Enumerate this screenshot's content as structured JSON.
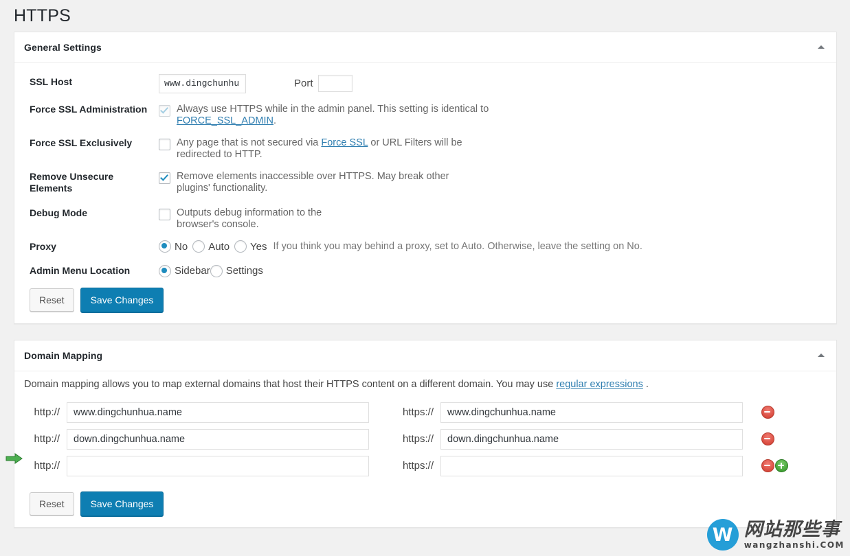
{
  "page": {
    "title": "HTTPS"
  },
  "general": {
    "heading": "General Settings",
    "toggle_icon": "triangle-up-icon",
    "rows": {
      "ssl_host": {
        "label": "SSL Host",
        "value": "www.dingchunhu",
        "placeholder": "",
        "port_label": "Port",
        "port_value": "",
        "port_placeholder": ""
      },
      "force_ssl_admin": {
        "label": "Force SSL Administration",
        "checked": true,
        "disabled": true,
        "text_before": "Always use HTTPS while in the admin panel. This setting is identical to ",
        "link_text": "FORCE_SSL_ADMIN",
        "text_after": "."
      },
      "force_ssl_exclusively": {
        "label": "Force SSL Exclusively",
        "checked": false,
        "text_before": "Any page that is not secured via ",
        "link_text": "Force SSL",
        "text_after": " or URL Filters will be redirected to HTTP."
      },
      "remove_unsecure": {
        "label": "Remove Unsecure Elements",
        "checked": true,
        "text": "Remove elements inaccessible over HTTPS. May break other plugins' functionality."
      },
      "debug_mode": {
        "label": "Debug Mode",
        "checked": false,
        "text": "Outputs debug information to the browser's console."
      },
      "proxy": {
        "label": "Proxy",
        "options": [
          "No",
          "Auto",
          "Yes"
        ],
        "selected": "No",
        "hint": "If you think you may behind a proxy, set to Auto. Otherwise, leave the setting on No."
      },
      "admin_menu_location": {
        "label": "Admin Menu Location",
        "options": [
          "Sidebar",
          "Settings"
        ],
        "selected": "Sidebar"
      }
    },
    "buttons": {
      "reset": "Reset",
      "save": "Save Changes"
    }
  },
  "domain_mapping": {
    "heading": "Domain Mapping",
    "toggle_icon": "triangle-up-icon",
    "description_before": "Domain mapping allows you to map external domains that host their HTTPS content on a different domain. You may use ",
    "description_link": "regular expressions",
    "description_after": " .",
    "http_prefix": "http://",
    "https_prefix": "https://",
    "rows": [
      {
        "http_value": "www.dingchunhua.name",
        "https_value": "www.dingchunhua.name",
        "has_add": false,
        "has_remove": true
      },
      {
        "http_value": "down.dingchunhua.name",
        "https_value": "down.dingchunhua.name",
        "has_add": false,
        "has_remove": true
      },
      {
        "http_value": "",
        "https_value": "",
        "has_add": true,
        "has_remove": true
      }
    ],
    "buttons": {
      "reset": "Reset",
      "save": "Save Changes"
    }
  },
  "annotation": {
    "arrow_icon": "green-arrow-right-icon"
  },
  "watermark": {
    "mark": "W",
    "name_cn": "网站那些事",
    "name_en": "wangzhanshi.COM",
    "brand_color": "#1b9ad6"
  },
  "colors": {
    "accent": "#0e7eb2",
    "link": "#2f7eb0",
    "checkbox_check": "#1e8cbe",
    "remove": "#d94b3f",
    "add": "#43a336",
    "page_bg": "#f1f1f1"
  }
}
